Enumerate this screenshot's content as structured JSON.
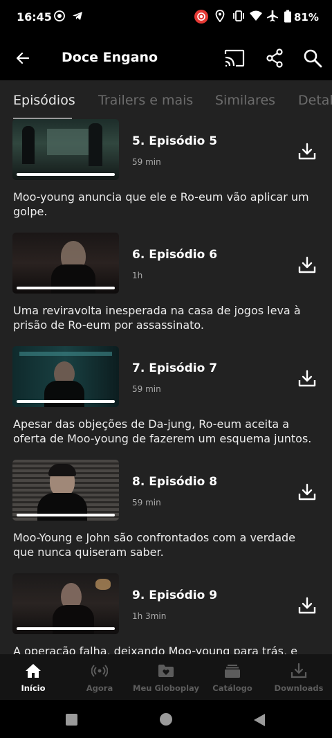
{
  "status_bar": {
    "time": "16:45",
    "battery": "81%"
  },
  "header": {
    "title": "Doce Engano"
  },
  "tabs": [
    {
      "label": "Episódios",
      "active": true
    },
    {
      "label": "Trailers e mais",
      "active": false
    },
    {
      "label": "Similares",
      "active": false
    },
    {
      "label": "Detalhes",
      "active": false
    }
  ],
  "episodes": [
    {
      "title": "5. Episódio 5",
      "duration": "59 min",
      "description": "Moo-young anuncia que ele e Ro-eum vão aplicar um golpe.",
      "progress": 1.0
    },
    {
      "title": "6. Episódio 6",
      "duration": "1h",
      "description": "Uma reviravolta inesperada na casa de jogos leva à prisão de Ro-eum por assassinato.",
      "progress": 1.0
    },
    {
      "title": "7. Episódio 7",
      "duration": "59 min",
      "description": "Apesar das objeções de Da-jung, Ro-eum aceita a oferta de Moo-young de fazerem um esquema juntos.",
      "progress": 1.0
    },
    {
      "title": "8. Episódio 8",
      "duration": "59 min",
      "description": "Moo-Young e John são confrontados com a verdade que nunca quiseram saber.",
      "progress": 1.0
    },
    {
      "title": "9. Episódio 9",
      "duration": "1h 3min",
      "description": "A operação falha, deixando Moo-young para trás, e",
      "progress": 1.0
    }
  ],
  "bottom_nav": [
    {
      "label": "Início",
      "icon": "home-icon",
      "active": true
    },
    {
      "label": "Agora",
      "icon": "live-broadcast-icon",
      "active": false
    },
    {
      "label": "Meu Globoplay",
      "icon": "folder-heart-icon",
      "active": false
    },
    {
      "label": "Catálogo",
      "icon": "catalog-stack-icon",
      "active": false
    },
    {
      "label": "Downloads",
      "icon": "download-icon",
      "active": false
    }
  ]
}
